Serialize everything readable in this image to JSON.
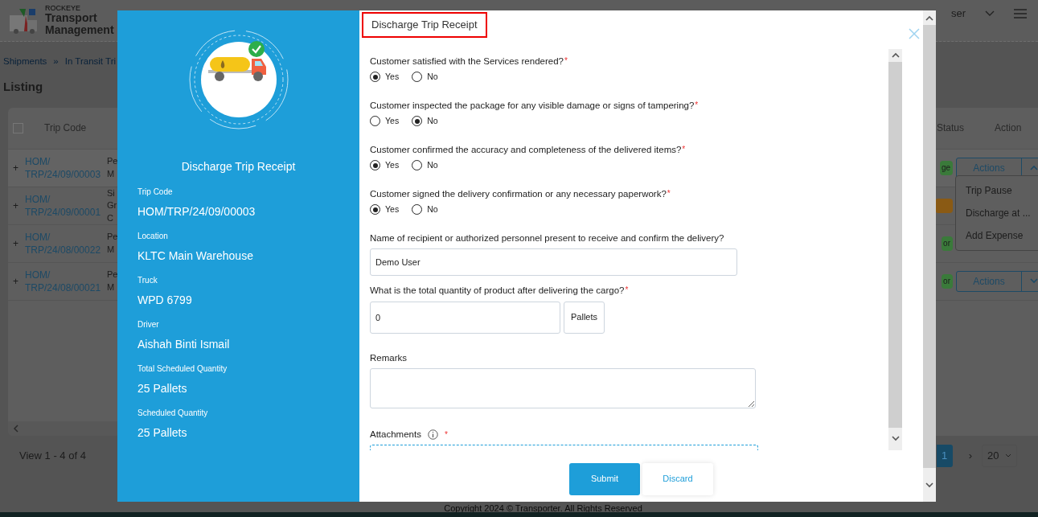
{
  "app": {
    "brand_small": "ROCKEYE",
    "brand": "Transport Management",
    "user": "ser"
  },
  "breadcrumb": [
    {
      "label": "Shipments"
    },
    {
      "separator": "»",
      "label": "In Transit Tri"
    }
  ],
  "page_title": "Listing",
  "table": {
    "select_all_checked": false,
    "columns": [
      "Trip Code",
      "Status",
      "Action"
    ],
    "rows": [
      {
        "expander": "+",
        "trip_code": "HOM/ TRP/24/09/00003",
        "column_2": [
          "Pe",
          "M"
        ],
        "status": "ge",
        "color": "#3a7a3a",
        "action": "Actions",
        "expanded": true
      },
      {
        "expander": "+",
        "trip_code": "HOM/ TRP/24/09/00001",
        "column_2": [
          "Si",
          "Gr",
          "C"
        ],
        "color": "#8a5a14"
      },
      {
        "expander": "+",
        "trip_code": "HOM/ TRP/24/08/00022",
        "column_2": [
          "Pe",
          "M"
        ],
        "status": "or",
        "color": "#3a7a3a"
      },
      {
        "expander": "+",
        "trip_code": "HOM/ TRP/24/08/00021",
        "column_2": [
          "Pe",
          "M"
        ],
        "status": "or",
        "color": "#3a7a3a",
        "action": "Actions",
        "expanded": false
      }
    ]
  },
  "action_menu": [
    "Trip Pause",
    "Discharge at ...",
    "Add Expense"
  ],
  "footer": {
    "summary": "View 1 - 4 of 4",
    "pages": [
      {
        "label": "1",
        "selected": true
      }
    ],
    "next": "›",
    "page_size": "20",
    "copyright": "Copyright 2024 © Transporter. All Rights Reserved"
  },
  "modal": {
    "side": {
      "title": "Discharge Trip Receipt",
      "fields": [
        {
          "label": "Trip Code",
          "value": "HOM/TRP/24/09/00003"
        },
        {
          "label": "Location",
          "value": "KLTC Main Warehouse"
        },
        {
          "label": "Truck",
          "value": "WPD 6799"
        },
        {
          "label": "Driver",
          "value": "Aishah Binti Ismail"
        },
        {
          "label": "Total Scheduled Quantity",
          "value": "25 Pallets"
        },
        {
          "label": "Scheduled Quantity",
          "value": "25 Pallets"
        }
      ]
    },
    "title": "Discharge Trip Receipt",
    "required_mark": "*",
    "questions": [
      {
        "label": "Customer satisfied with the Services rendered?",
        "required": true,
        "options": [
          {
            "label": "Yes",
            "selected": true
          },
          {
            "label": "No",
            "selected": false
          }
        ]
      },
      {
        "label": "Customer inspected the package for any visible damage or signs of tampering?",
        "required": true,
        "options": [
          {
            "label": "Yes",
            "selected": false
          },
          {
            "label": "No",
            "selected": true
          }
        ]
      },
      {
        "label": "Customer confirmed the accuracy and completeness of the delivered items?",
        "required": true,
        "options": [
          {
            "label": "Yes",
            "selected": true
          },
          {
            "label": "No",
            "selected": false
          }
        ]
      },
      {
        "label": "Customer signed the delivery confirmation or any necessary paperwork?",
        "required": true,
        "options": [
          {
            "label": "Yes",
            "selected": true
          },
          {
            "label": "No",
            "selected": false
          }
        ]
      }
    ],
    "recipient": {
      "label": "Name of recipient or authorized personnel present to receive and confirm the delivery?",
      "value": "Demo User"
    },
    "quantity": {
      "label": "What is the total quantity of product after delivering the cargo?",
      "required": true,
      "value": "0",
      "unit": "Pallets"
    },
    "remarks": {
      "label": "Remarks"
    },
    "attachments": {
      "label": "Attachments",
      "required": true
    },
    "buttons": [
      {
        "label": "Submit",
        "kind": "primary"
      },
      {
        "label": "Discard",
        "kind": "secondary"
      }
    ]
  }
}
